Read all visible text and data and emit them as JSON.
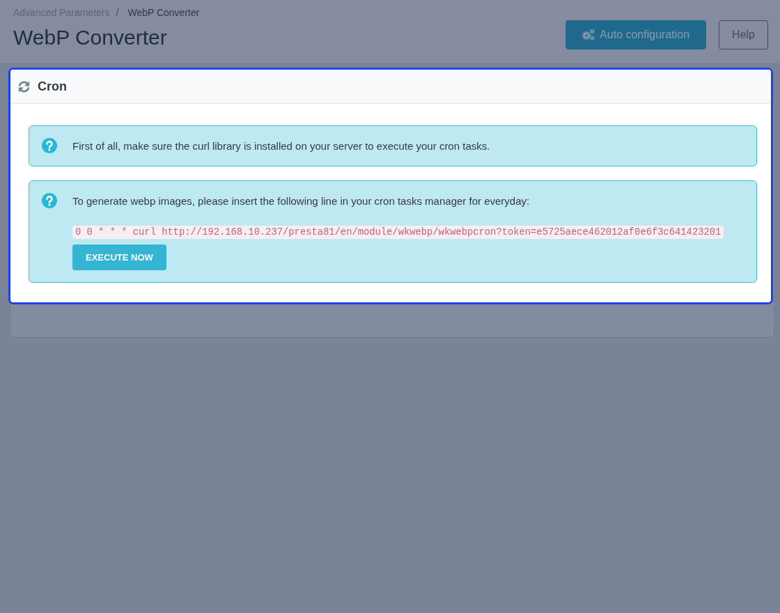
{
  "breadcrumb": {
    "items": [
      {
        "label": "Advanced Parameters",
        "current": false
      },
      {
        "label": "WebP Converter",
        "current": true
      }
    ],
    "separator": "/"
  },
  "page_title": "WebP Converter",
  "toolbar_buttons": [
    {
      "kind": "primary",
      "label": "Auto configuration"
    },
    {
      "kind": "outline",
      "label": "Help"
    }
  ],
  "panel": {
    "title": "Cron",
    "highlighted": true,
    "alerts": [
      {
        "text": "First of all, make sure the curl library is installed on your server to execute your cron tasks."
      },
      {
        "text": "To generate webp images, please insert the following line in your cron tasks manager for everyday:",
        "code": "0 0 * * * curl http://192.168.10.237/presta81/en/module/wkwebp/wkwebpcron?token=e5725aece462012af0e6f3c641423201",
        "button": "EXECUTE NOW"
      }
    ]
  }
}
